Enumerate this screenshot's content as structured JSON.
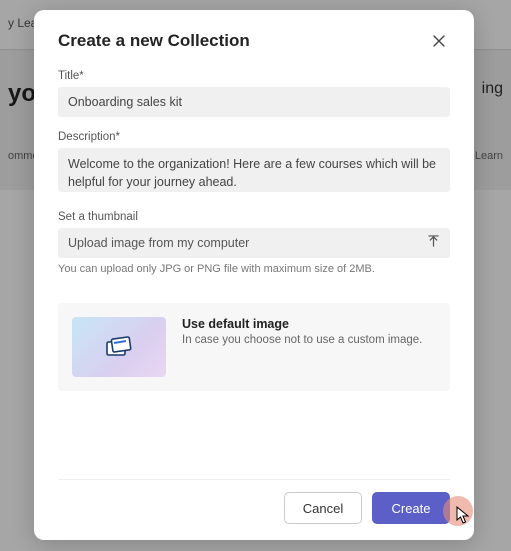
{
  "modal": {
    "title": "Create a new Collection",
    "title_field": {
      "label": "Title*",
      "value": "Onboarding sales kit"
    },
    "description_field": {
      "label": "Description*",
      "value": "Welcome to the organization! Here are a few courses which will be helpful for your journey ahead."
    },
    "thumbnail": {
      "label": "Set a thumbnail",
      "upload_text": "Upload image from my computer",
      "helper": "You can upload only JPG or PNG file with maximum size of 2MB."
    },
    "default_image": {
      "heading": "Use default image",
      "subtext": "In case you choose not to use a custom image."
    },
    "buttons": {
      "cancel": "Cancel",
      "create": "Create"
    }
  },
  "background": {
    "top_left": "y Learn",
    "mid_left": "you",
    "mid_right": "ing",
    "sub_left": "ommer",
    "sub_right": "edIn Learn"
  }
}
